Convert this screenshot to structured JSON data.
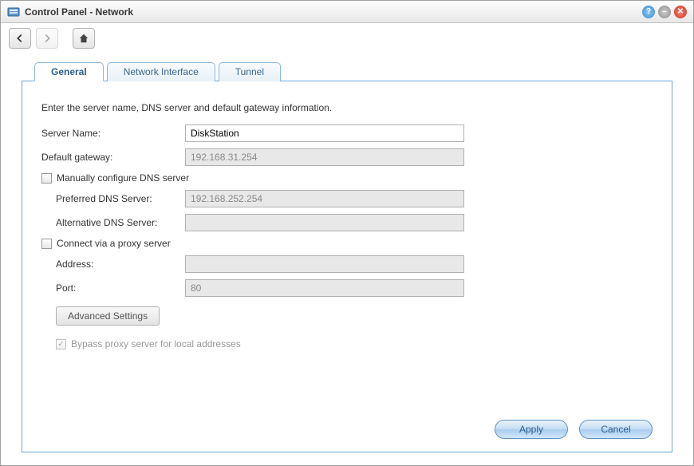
{
  "window": {
    "title": "Control Panel - Network"
  },
  "tabs": [
    {
      "label": "General"
    },
    {
      "label": "Network Interface"
    },
    {
      "label": "Tunnel"
    }
  ],
  "panel": {
    "description": "Enter the server name, DNS server and default gateway information.",
    "server_name_label": "Server Name:",
    "server_name_value": "DiskStation",
    "default_gateway_label": "Default gateway:",
    "default_gateway_value": "192.168.31.254",
    "manual_dns_label": "Manually configure DNS server",
    "preferred_dns_label": "Preferred DNS Server:",
    "preferred_dns_value": "192.168.252.254",
    "alt_dns_label": "Alternative DNS Server:",
    "alt_dns_value": "",
    "proxy_label": "Connect via a proxy server",
    "proxy_address_label": "Address:",
    "proxy_address_value": "",
    "proxy_port_label": "Port:",
    "proxy_port_value": "80",
    "advanced_btn": "Advanced Settings",
    "bypass_label": "Bypass proxy server for local addresses"
  },
  "footer": {
    "apply": "Apply",
    "cancel": "Cancel"
  }
}
